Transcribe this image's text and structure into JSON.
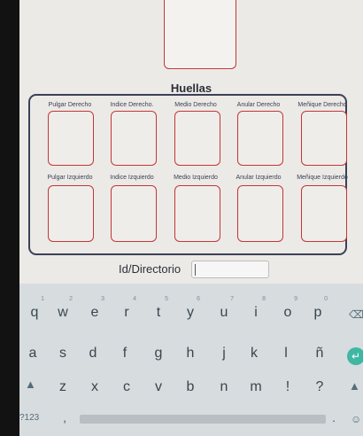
{
  "section_title": "Huellas",
  "fingers_top": [
    "Pulgar Derecho",
    "Indice Derecho.",
    "Medio Derecho",
    "Anular Derecho",
    "Meñique Derecho"
  ],
  "fingers_bottom": [
    "Pulgar Izquierdo",
    "Indice Izquierdo",
    "Medio Izquierdo",
    "Anular Izquierdo",
    "Meñique Izquierdo"
  ],
  "id_label": "Id/Directorio",
  "id_value": "",
  "keyboard": {
    "row1": [
      "q",
      "w",
      "e",
      "r",
      "t",
      "y",
      "u",
      "i",
      "o",
      "p"
    ],
    "row1_sup": [
      "1",
      "2",
      "3",
      "4",
      "5",
      "6",
      "7",
      "8",
      "9",
      "0"
    ],
    "row2": [
      "a",
      "s",
      "d",
      "f",
      "g",
      "h",
      "j",
      "k",
      "l",
      "ñ"
    ],
    "row3": [
      "z",
      "x",
      "c",
      "v",
      "b",
      "n",
      "m",
      "!",
      "?"
    ],
    "symbols_label": "?123",
    "comma": ",",
    "period": "."
  },
  "icons": {
    "backspace": "backspace-icon",
    "enter": "enter-icon",
    "shift": "shift-icon",
    "emoji": "emoji-icon"
  }
}
